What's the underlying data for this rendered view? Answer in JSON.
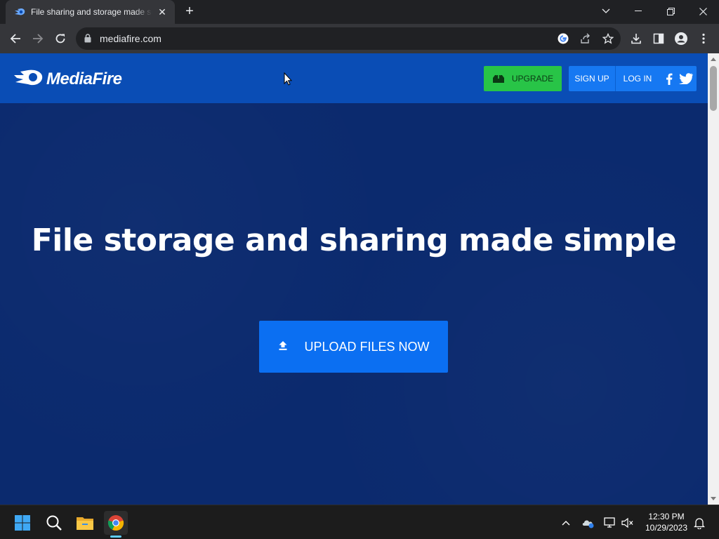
{
  "browser": {
    "tab_title": "File sharing and storage made simple",
    "url": "mediafire.com"
  },
  "site": {
    "brand": "MediaFire",
    "nav": {
      "upgrade_label": "UPGRADE",
      "signup_label": "SIGN UP",
      "login_label": "LOG IN"
    },
    "hero": {
      "title": "File storage and sharing made simple",
      "upload_label": "UPLOAD FILES NOW"
    },
    "colors": {
      "header": "#0a4db5",
      "hero_bg": "#0b2a6e",
      "upgrade": "#28c447",
      "primary": "#1678f2"
    }
  },
  "taskbar": {
    "time": "12:30 PM",
    "date": "10/29/2023"
  }
}
